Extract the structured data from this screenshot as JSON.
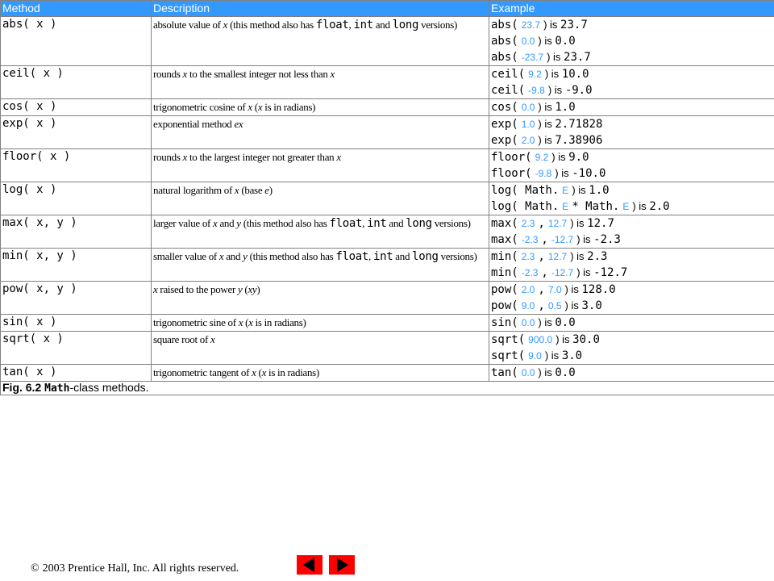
{
  "table": {
    "headers": [
      "Method",
      "Description",
      "Example"
    ],
    "rows": [
      {
        "method": "abs( x )",
        "description": "absolute value of x (this method also has float, int and long versions)",
        "examples": [
          {
            "pre": "abs(",
            "val": "23.7",
            "post": ") is",
            "res": "23.7"
          },
          {
            "pre": "abs(",
            "val": "0.0",
            "post": ") is",
            "res": "0.0"
          },
          {
            "pre": "abs(",
            "val": "-23.7",
            "post": ") is",
            "res": "23.7"
          }
        ]
      },
      {
        "method": "ceil( x )",
        "description": "rounds x to the smallest integer not less than x",
        "examples": [
          {
            "pre": "ceil(",
            "val": "9.2",
            "post": ") is",
            "res": "10.0"
          },
          {
            "pre": "ceil(",
            "val": "-9.8",
            "post": ") is",
            "res": "-9.0"
          }
        ]
      },
      {
        "method": "cos( x )",
        "description": "trigonometric cosine of x (x is in radians)",
        "examples": [
          {
            "pre": "cos(",
            "val": "0.0",
            "post": ") is",
            "res": "1.0"
          }
        ]
      },
      {
        "method": "exp( x )",
        "description": "exponential method ex",
        "examples": [
          {
            "pre": "exp(",
            "val": "1.0",
            "post": ") is",
            "res": "2.71828"
          },
          {
            "pre": "exp(",
            "val": "2.0",
            "post": ") is",
            "res": "7.38906"
          }
        ]
      },
      {
        "method": "floor( x )",
        "description": "rounds x to the largest integer not greater than x",
        "examples": [
          {
            "pre": "floor(",
            "val": "9.2",
            "post": ") is",
            "res": "9.0"
          },
          {
            "pre": "floor(",
            "val": "-9.8",
            "post": ") is",
            "res": "-10.0"
          }
        ]
      },
      {
        "method": "log( x )",
        "description": "natural logarithm of x (base e)",
        "examples": [
          {
            "pre": "log( Math.",
            "val": "E",
            "post": ") is",
            "res": "1.0"
          },
          {
            "pre": "log( Math.",
            "val": "E",
            "mid": "* Math.",
            "val2": "E",
            "post": ") is",
            "res": "2.0"
          }
        ]
      },
      {
        "method": "max( x, y )",
        "description": "larger value of x and y (this method also has float, int and long versions)",
        "examples": [
          {
            "pre": "max(",
            "val": "2.3",
            "mid": ",",
            "val2": "12.7",
            "post": ") is",
            "res": "12.7"
          },
          {
            "pre": "max(",
            "val": "-2.3",
            "mid": ",",
            "val2": "-12.7",
            "post": ") is",
            "res": "-2.3"
          }
        ]
      },
      {
        "method": "min( x, y )",
        "description": "smaller value of x and y (this method also has float, int and long versions)",
        "examples": [
          {
            "pre": "min(",
            "val": "2.3",
            "mid": ",",
            "val2": "12.7",
            "post": ") is",
            "res": "2.3"
          },
          {
            "pre": "min(",
            "val": "-2.3",
            "mid": ",",
            "val2": "-12.7",
            "post": ") is",
            "res": "-12.7"
          }
        ]
      },
      {
        "method": "pow( x, y )",
        "description": "x raised to the power y (xy)",
        "examples": [
          {
            "pre": "pow(",
            "val": "2.0",
            "mid": ",",
            "val2": "7.0",
            "post": ") is",
            "res": "128.0"
          },
          {
            "pre": "pow(",
            "val": "9.0",
            "mid": ",",
            "val2": "0.5",
            "post": ") is",
            "res": "3.0"
          }
        ]
      },
      {
        "method": "sin( x )",
        "description": "trigonometric sine of x (x is in radians)",
        "examples": [
          {
            "pre": "sin(",
            "val": "0.0",
            "post": ") is",
            "res": "0.0"
          }
        ]
      },
      {
        "method": "sqrt( x )",
        "description": "square root of x",
        "examples": [
          {
            "pre": "sqrt(",
            "val": "900.0",
            "post": ") is",
            "res": "30.0"
          },
          {
            "pre": "sqrt(",
            "val": "9.0",
            "post": ") is",
            "res": "3.0"
          }
        ]
      },
      {
        "method": "tan( x )",
        "description": "trigonometric tangent of x (x is in radians)",
        "examples": [
          {
            "pre": "tan(",
            "val": "0.0",
            "post": ") is",
            "res": "0.0"
          }
        ]
      }
    ],
    "caption": {
      "fig": "Fig. 6.2",
      "cls": "Math",
      "rest": "-class methods."
    }
  },
  "footer": {
    "copyright_symbol": "©",
    "copyright": "2003 Prentice Hall, Inc.  All rights reserved."
  },
  "nav": {
    "prev_icon": "left-arrow-icon",
    "next_icon": "right-arrow-icon",
    "button_color": "#ff0000",
    "arrow_color": "#000000"
  },
  "colors": {
    "header_bg": "#3399ff",
    "value_text": "#3399ff"
  }
}
